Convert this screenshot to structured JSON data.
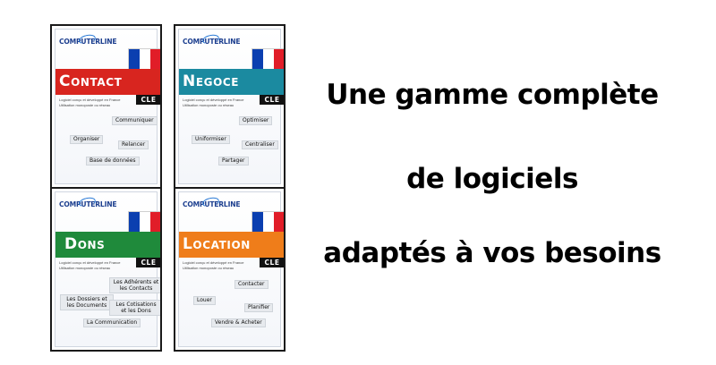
{
  "cards": [
    {
      "logo": "COMPUTERLINE",
      "name": "Contact",
      "badge": "CLE",
      "description": "Logiciel conçu et développé en France\nUtilisation monoposte ou réseau",
      "band_color": "#d8251f",
      "tags": [
        "Communiquer",
        "Organiser",
        "Relancer",
        "Base de données"
      ]
    },
    {
      "logo": "COMPUTERLINE",
      "name": "Negoce",
      "badge": "CLE",
      "description": "Logiciel conçu et développé en France\nUtilisation monoposte ou réseau",
      "band_color": "#1b8aa0",
      "tags": [
        "Optimiser",
        "Uniformiser",
        "Centraliser",
        "Partager"
      ]
    },
    {
      "logo": "COMPUTERLINE",
      "name": "Dons",
      "badge": "CLE",
      "description": "Logiciel conçu et développé en France\nUtilisation monoposte ou réseau",
      "band_color": "#1f8a3b",
      "tags": [
        "Les Adhérents et les Contacts",
        "Les Dossiers et les Documents",
        "Les Cotisations et les Dons",
        "La Communication"
      ]
    },
    {
      "logo": "COMPUTERLINE",
      "name": "Location",
      "badge": "CLE",
      "description": "Logiciel conçu et développé en France\nUtilisation monoposte ou réseau",
      "band_color": "#ef7d1a",
      "tags": [
        "Contacter",
        "Louer",
        "Planifier",
        "Vendre & Acheter"
      ]
    }
  ],
  "headline": {
    "line1": "Une gamme complète",
    "line2": "de logiciels",
    "line3": "adaptés à vos besoins"
  }
}
